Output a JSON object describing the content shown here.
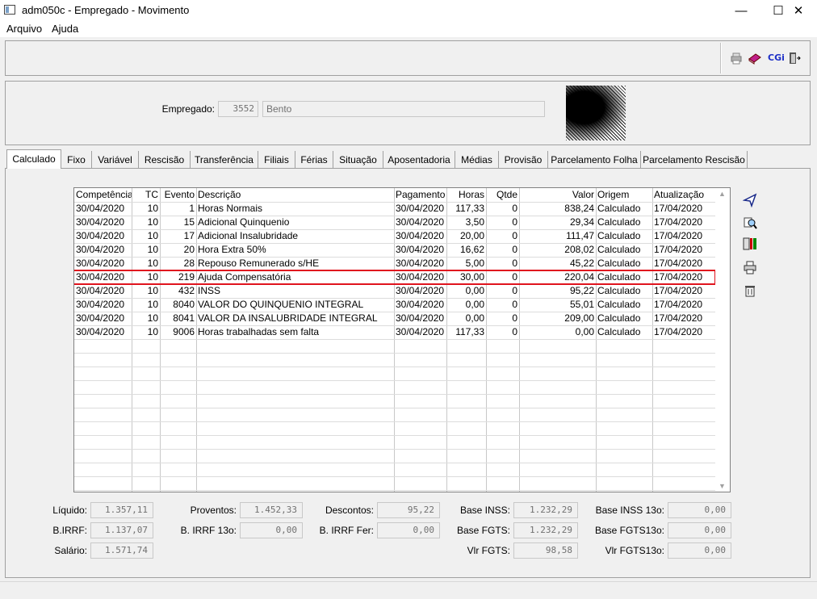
{
  "window": {
    "title": "adm050c - Empregado - Movimento",
    "minimize": "—",
    "maximize": "☐",
    "close": "✕"
  },
  "menu": {
    "items": [
      "Arquivo",
      "Ajuda"
    ]
  },
  "toolbar": {
    "icons": [
      "printer-icon",
      "book-icon",
      "cgi-icon",
      "exit-icon"
    ],
    "cgi_label": "CGi"
  },
  "employee": {
    "label": "Empregado:",
    "code": "3552",
    "name": "Bento"
  },
  "tabs": [
    "Calculado",
    "Fixo",
    "Variável",
    "Rescisão",
    "Transferência",
    "Filiais",
    "Férias",
    "Situação",
    "Aposentadoria",
    "Médias",
    "Provisão",
    "Parcelamento Folha",
    "Parcelamento Rescisão"
  ],
  "active_tab": "Calculado",
  "table": {
    "columns": [
      "Competência",
      "TC",
      "Evento",
      "Descrição",
      "Pagamento",
      "Horas",
      "Qtde",
      "Valor",
      "Origem",
      "Atualização"
    ],
    "rows": [
      [
        "30/04/2020",
        "10",
        "1",
        "Horas Normais",
        "30/04/2020",
        "117,33",
        "0",
        "838,24",
        "Calculado",
        "17/04/2020"
      ],
      [
        "30/04/2020",
        "10",
        "15",
        "Adicional Quinquenio",
        "30/04/2020",
        "3,50",
        "0",
        "29,34",
        "Calculado",
        "17/04/2020"
      ],
      [
        "30/04/2020",
        "10",
        "17",
        "Adicional Insalubridade",
        "30/04/2020",
        "20,00",
        "0",
        "111,47",
        "Calculado",
        "17/04/2020"
      ],
      [
        "30/04/2020",
        "10",
        "20",
        "Hora Extra 50%",
        "30/04/2020",
        "16,62",
        "0",
        "208,02",
        "Calculado",
        "17/04/2020"
      ],
      [
        "30/04/2020",
        "10",
        "28",
        "Repouso Remunerado s/HE",
        "30/04/2020",
        "5,00",
        "0",
        "45,22",
        "Calculado",
        "17/04/2020"
      ],
      [
        "30/04/2020",
        "10",
        "219",
        "Ajuda Compensatória",
        "30/04/2020",
        "30,00",
        "0",
        "220,04",
        "Calculado",
        "17/04/2020"
      ],
      [
        "30/04/2020",
        "10",
        "432",
        "INSS",
        "30/04/2020",
        "0,00",
        "0",
        "95,22",
        "Calculado",
        "17/04/2020"
      ],
      [
        "30/04/2020",
        "10",
        "8040",
        "VALOR DO QUINQUENIO INTEGRAL",
        "30/04/2020",
        "0,00",
        "0",
        "55,01",
        "Calculado",
        "17/04/2020"
      ],
      [
        "30/04/2020",
        "10",
        "8041",
        "VALOR DA INSALUBRIDADE INTEGRAL",
        "30/04/2020",
        "0,00",
        "0",
        "209,00",
        "Calculado",
        "17/04/2020"
      ],
      [
        "30/04/2020",
        "10",
        "9006",
        "Horas trabalhadas sem falta",
        "30/04/2020",
        "117,33",
        "0",
        "0,00",
        "Calculado",
        "17/04/2020"
      ]
    ],
    "highlighted_row": 5,
    "highlight_color": "#e0141e"
  },
  "side_actions": [
    "send-icon",
    "search-icon",
    "calculator-icon",
    "print-icon",
    "trash-icon"
  ],
  "totals": {
    "liquido": {
      "label": "Líquido:",
      "value": "1.357,11"
    },
    "birrf": {
      "label": "B.IRRF:",
      "value": "1.137,07"
    },
    "salario": {
      "label": "Salário:",
      "value": "1.571,74"
    },
    "proventos": {
      "label": "Proventos:",
      "value": "1.452,33"
    },
    "birrf13": {
      "label": "B. IRRF 13o:",
      "value": "0,00"
    },
    "descontos": {
      "label": "Descontos:",
      "value": "95,22"
    },
    "birrffer": {
      "label": "B. IRRF Fer:",
      "value": "0,00"
    },
    "baseinss": {
      "label": "Base INSS:",
      "value": "1.232,29"
    },
    "basefgts": {
      "label": "Base FGTS:",
      "value": "1.232,29"
    },
    "vlrfgts": {
      "label": "Vlr FGTS:",
      "value": "98,58"
    },
    "baseinss13": {
      "label": "Base INSS 13o:",
      "value": "0,00"
    },
    "basefgts13": {
      "label": "Base FGTS13o:",
      "value": "0,00"
    },
    "vlrfgts13": {
      "label": "Vlr FGTS13o:",
      "value": "0,00"
    }
  }
}
